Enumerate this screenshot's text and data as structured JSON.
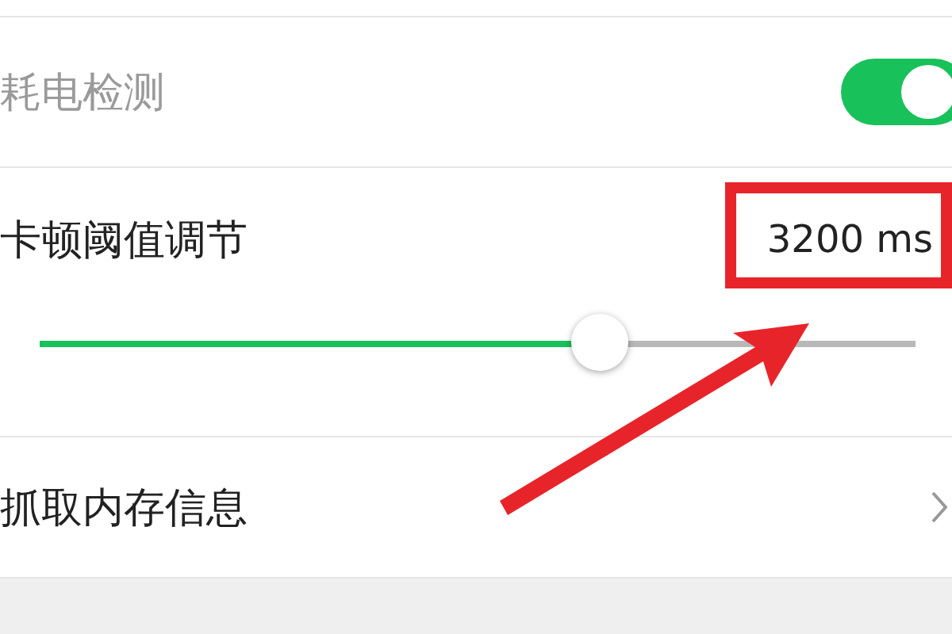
{
  "rows": [
    {
      "kind": "toggle",
      "label": "耗电检测",
      "disabled": true,
      "on": true
    },
    {
      "kind": "slider",
      "label": "卡顿阈值调节",
      "reading": "3200 ms",
      "level": 0.64
    },
    {
      "kind": "link",
      "label": "抓取内存信息"
    }
  ]
}
